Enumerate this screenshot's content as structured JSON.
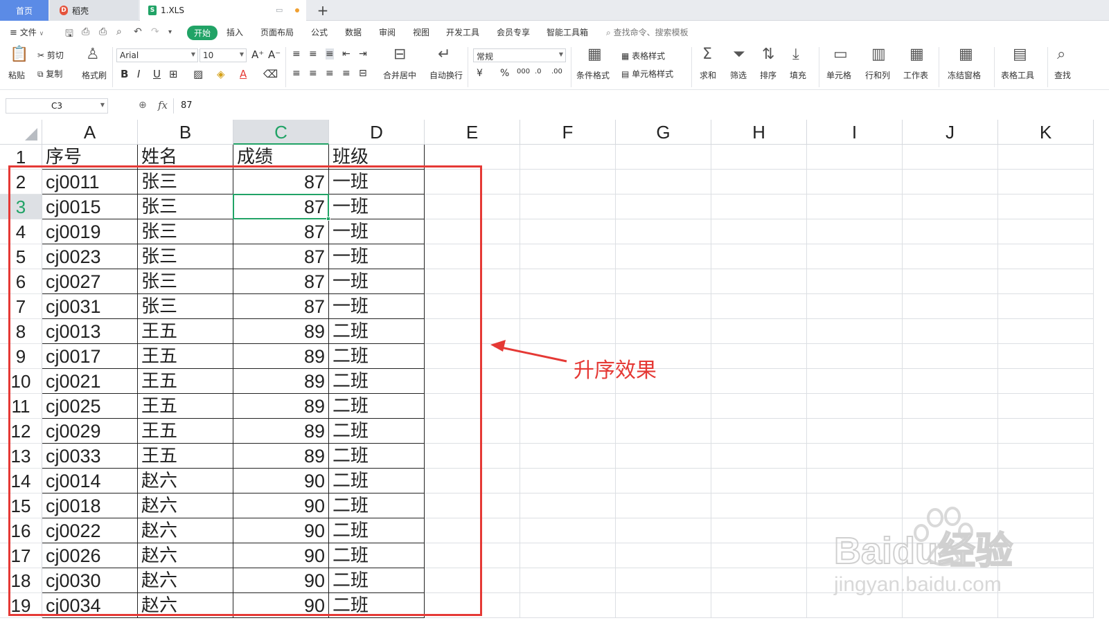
{
  "tabs": {
    "home": "首页",
    "daoke": "稻壳",
    "file": "1.XLS",
    "new_tab": "+"
  },
  "menu": {
    "file": "文件",
    "items": [
      "开始",
      "插入",
      "页面布局",
      "公式",
      "数据",
      "审阅",
      "视图",
      "开发工具",
      "会员专享",
      "智能工具箱"
    ],
    "search": "查找命令、搜索模板"
  },
  "ribbon": {
    "paste": "粘贴",
    "cut": "剪切",
    "copy": "复制",
    "format_painter": "格式刷",
    "font_name": "Arial",
    "font_size": "10",
    "merge": "合并居中",
    "wrap": "自动换行",
    "number_format": "常规",
    "cond_format": "条件格式",
    "table_style": "表格样式",
    "cell_style": "单元格样式",
    "sum": "求和",
    "filter": "筛选",
    "sort": "排序",
    "fill": "填充",
    "cell": "单元格",
    "rowcol": "行和列",
    "sheet": "工作表",
    "freeze": "冻结窗格",
    "table_tools": "表格工具",
    "find": "查找"
  },
  "formula_bar": {
    "name_box": "C3",
    "fx": "fx",
    "value": "87"
  },
  "columns": [
    "A",
    "B",
    "C",
    "D",
    "E",
    "F",
    "G",
    "H",
    "I",
    "J",
    "K"
  ],
  "active_column": "C",
  "active_row": "3",
  "rows": [
    {
      "n": "1",
      "a": "序号",
      "b": "姓名",
      "c": "成绩",
      "d": "班级"
    },
    {
      "n": "2",
      "a": "cj0011",
      "b": "张三",
      "c": "87",
      "d": "一班"
    },
    {
      "n": "3",
      "a": "cj0015",
      "b": "张三",
      "c": "87",
      "d": "一班"
    },
    {
      "n": "4",
      "a": "cj0019",
      "b": "张三",
      "c": "87",
      "d": "一班"
    },
    {
      "n": "5",
      "a": "cj0023",
      "b": "张三",
      "c": "87",
      "d": "一班"
    },
    {
      "n": "6",
      "a": "cj0027",
      "b": "张三",
      "c": "87",
      "d": "一班"
    },
    {
      "n": "7",
      "a": "cj0031",
      "b": "张三",
      "c": "87",
      "d": "一班"
    },
    {
      "n": "8",
      "a": "cj0013",
      "b": "王五",
      "c": "89",
      "d": "二班"
    },
    {
      "n": "9",
      "a": "cj0017",
      "b": "王五",
      "c": "89",
      "d": "二班"
    },
    {
      "n": "10",
      "a": "cj0021",
      "b": "王五",
      "c": "89",
      "d": "二班"
    },
    {
      "n": "11",
      "a": "cj0025",
      "b": "王五",
      "c": "89",
      "d": "二班"
    },
    {
      "n": "12",
      "a": "cj0029",
      "b": "王五",
      "c": "89",
      "d": "二班"
    },
    {
      "n": "13",
      "a": "cj0033",
      "b": "王五",
      "c": "89",
      "d": "二班"
    },
    {
      "n": "14",
      "a": "cj0014",
      "b": "赵六",
      "c": "90",
      "d": "二班"
    },
    {
      "n": "15",
      "a": "cj0018",
      "b": "赵六",
      "c": "90",
      "d": "二班"
    },
    {
      "n": "16",
      "a": "cj0022",
      "b": "赵六",
      "c": "90",
      "d": "二班"
    },
    {
      "n": "17",
      "a": "cj0026",
      "b": "赵六",
      "c": "90",
      "d": "二班"
    },
    {
      "n": "18",
      "a": "cj0030",
      "b": "赵六",
      "c": "90",
      "d": "二班"
    },
    {
      "n": "19",
      "a": "cj0034",
      "b": "赵六",
      "c": "90",
      "d": "二班"
    }
  ],
  "annotation": "升序效果",
  "watermark": {
    "brand": "Baidu经验",
    "url": "jingyan.baidu.com"
  },
  "colors": {
    "accent": "#21a366",
    "annotation": "#e53935",
    "home_tab": "#5b8be6"
  }
}
